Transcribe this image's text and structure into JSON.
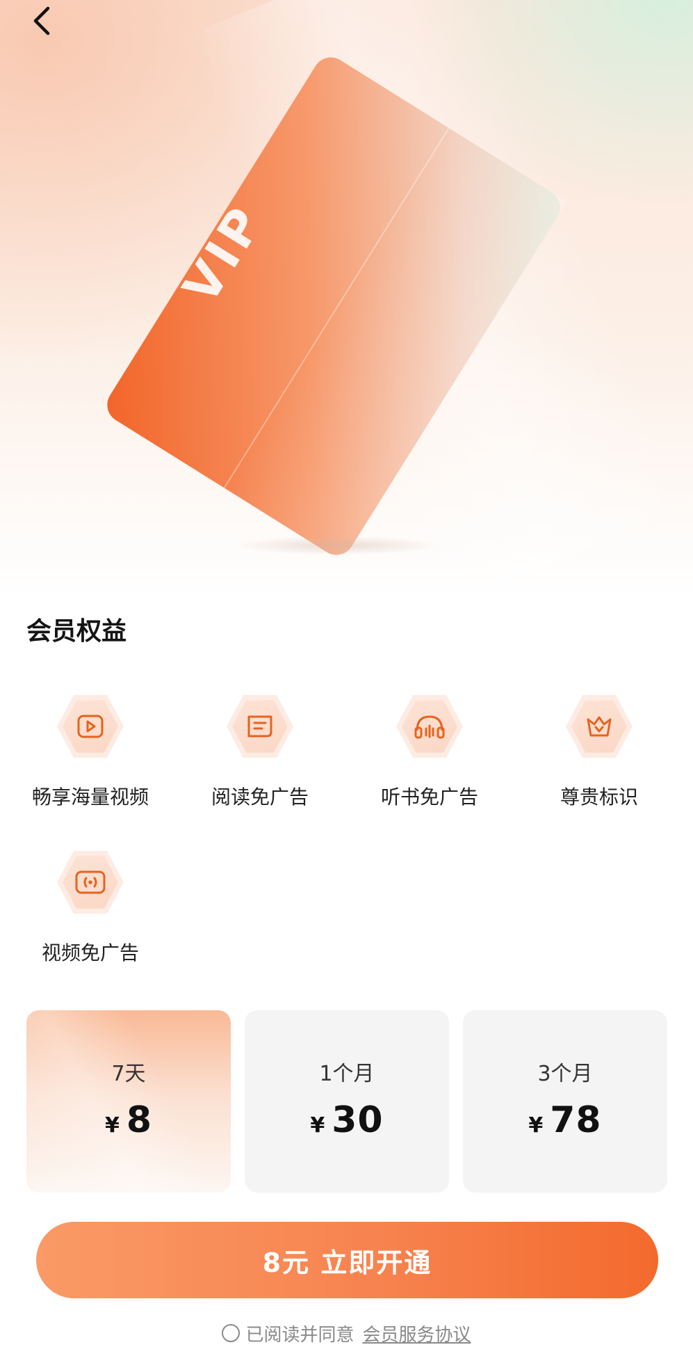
{
  "nav": {
    "back_icon": "chevron-left-icon"
  },
  "hero": {
    "card_text": "VIP",
    "accent": "#f36a2d"
  },
  "benefits": {
    "title": "会员权益",
    "items": [
      {
        "label": "畅享海量视频",
        "icon": "play-icon"
      },
      {
        "label": "阅读免广告",
        "icon": "book-icon"
      },
      {
        "label": "听书免广告",
        "icon": "headphones-icon"
      },
      {
        "label": "尊贵标识",
        "icon": "crown-icon"
      },
      {
        "label": "视频免广告",
        "icon": "broadcast-icon"
      }
    ]
  },
  "plans": [
    {
      "name": "7天",
      "currency": "¥",
      "price": "8",
      "selected": true
    },
    {
      "name": "1个月",
      "currency": "¥",
      "price": "30",
      "selected": false
    },
    {
      "name": "3个月",
      "currency": "¥",
      "price": "78",
      "selected": false
    }
  ],
  "cta": {
    "label": "8元 立即开通"
  },
  "agreement": {
    "text": "已阅读并同意",
    "link": "会员服务协议",
    "checked": false
  }
}
